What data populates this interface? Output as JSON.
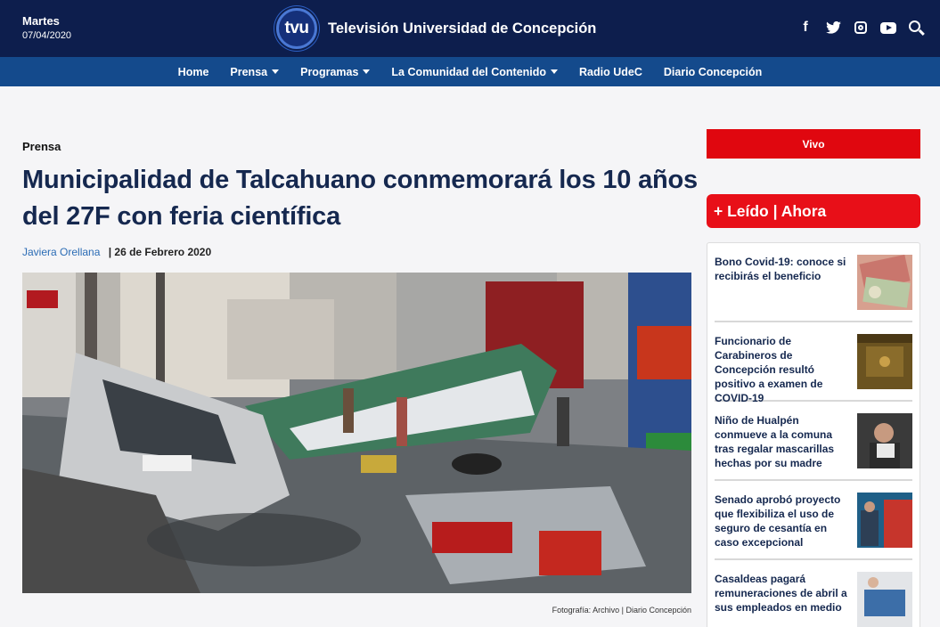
{
  "header": {
    "day": "Martes",
    "date": "07/04/2020",
    "logo_text": "tvu",
    "site_name": "Televisión Universidad de Concepción",
    "social": [
      "facebook-icon",
      "twitter-icon",
      "instagram-icon",
      "youtube-icon",
      "search-icon"
    ]
  },
  "nav": {
    "items": [
      {
        "label": "Home",
        "dropdown": false
      },
      {
        "label": "Prensa",
        "dropdown": true
      },
      {
        "label": "Programas",
        "dropdown": true
      },
      {
        "label": "La Comunidad del Contenido",
        "dropdown": true
      },
      {
        "label": "Radio UdeC",
        "dropdown": false
      },
      {
        "label": "Diario Concepción",
        "dropdown": false
      }
    ]
  },
  "article": {
    "category": "Prensa",
    "title": "Municipalidad de Talcahuano conmemorará los 10 años del 27F con feria científica",
    "author": "Javiera Orellana",
    "date": "| 26 de Febrero 2020",
    "caption": "Fotografía: Archivo | Diario Concepción"
  },
  "sidebar": {
    "live_label": "Vivo",
    "most_read_label": "+ Leído | Ahora",
    "items": [
      {
        "title": "Bono Covid-19: conoce si recibirás el beneficio"
      },
      {
        "title": "Funcionario de Carabineros de Concepción resultó positivo a examen de COVID-19"
      },
      {
        "title": "Niño de Hualpén conmueve a la comuna tras regalar mascarillas hechas por su madre"
      },
      {
        "title": "Senado aprobó proyecto que flexibiliza el uso de seguro de cesantía en caso excepcional"
      },
      {
        "title": "Casaldeas pagará remuneraciones de abril a sus empleados en medio"
      }
    ]
  },
  "colors": {
    "header_bg": "#0d1e4d",
    "nav_bg": "#144a8c",
    "accent_red": "#e0070f",
    "headline": "#15284f",
    "link": "#2b6cb5"
  }
}
